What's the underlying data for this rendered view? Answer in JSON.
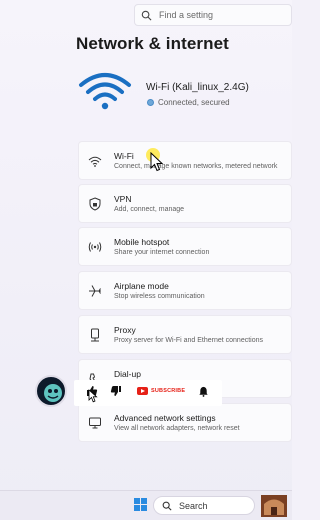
{
  "search": {
    "placeholder": "Find a setting"
  },
  "page": {
    "title": "Network & internet"
  },
  "hero": {
    "ssid": "Wi-Fi (Kali_linux_2.4G)",
    "status": "Connected, secured",
    "icon": "wifi-icon"
  },
  "items": [
    {
      "title": "Wi-Fi",
      "subtitle": "Connect, manage known networks, metered network",
      "icon": "wifi-icon"
    },
    {
      "title": "VPN",
      "subtitle": "Add, connect, manage",
      "icon": "shield-icon"
    },
    {
      "title": "Mobile hotspot",
      "subtitle": "Share your internet connection",
      "icon": "hotspot-icon"
    },
    {
      "title": "Airplane mode",
      "subtitle": "Stop wireless communication",
      "icon": "airplane-icon"
    },
    {
      "title": "Proxy",
      "subtitle": "Proxy server for Wi-Fi and Ethernet connections",
      "icon": "proxy-icon"
    },
    {
      "title": "Dial-up",
      "subtitle": "",
      "icon": "phone-icon"
    },
    {
      "title": "Advanced network settings",
      "subtitle": "View all network adapters, network reset",
      "icon": "monitor-icon"
    }
  ],
  "overlay": {
    "subscribe": "SUBSCRIBE"
  },
  "taskbar": {
    "search_placeholder": "Search"
  },
  "colors": {
    "accent": "#0067c0",
    "subscribe": "#e62117"
  }
}
